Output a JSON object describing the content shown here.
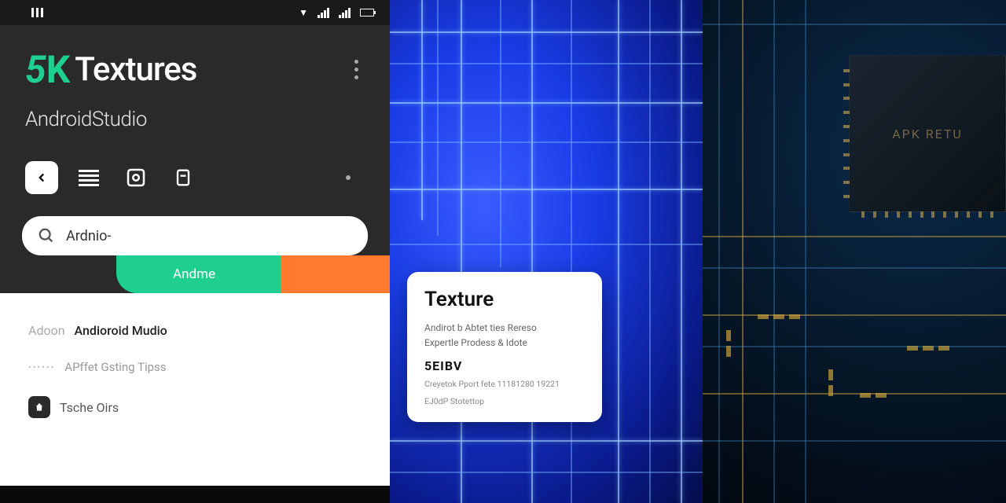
{
  "status": {
    "carrier_icon": "▮"
  },
  "header": {
    "brand_prefix": "5",
    "brand_k": "K",
    "brand_word": "Textures",
    "subtitle": "AndroidStudio"
  },
  "search": {
    "value": "Ardnio-"
  },
  "pill": {
    "label": "Andme"
  },
  "list": {
    "row1_prefix": "Adoon",
    "row1_bold": "Andioroid Mudio",
    "row2_text": "APffet Gsting Tipss",
    "row3_text": "Tsche Oirs"
  },
  "card": {
    "title": "Texture",
    "line1": "Andirot b Abtet ties Rereso",
    "line2": "Expertle Prodess & Idote",
    "heavy": "5EIBV",
    "small1": "Creyetok Pport fete 11181280 19221",
    "small2": "EJ0dP Stotettop"
  },
  "chip": {
    "label": "APK RETU"
  }
}
